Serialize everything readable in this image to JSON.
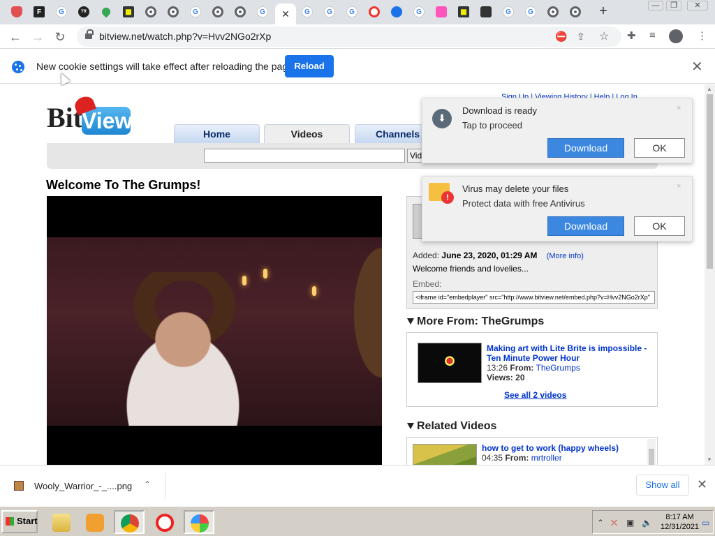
{
  "browser": {
    "url": "bitview.net/watch.php?v=Hvv2NGo2rXp",
    "tabs": [
      {
        "icon": "shield-icon"
      },
      {
        "icon": "f-square-icon",
        "glyph": "F"
      },
      {
        "icon": "google-g-icon",
        "glyph": "G"
      },
      {
        "icon": "tr-icon",
        "glyph": "TR"
      },
      {
        "icon": "maps-pin-icon"
      },
      {
        "icon": "film-icon",
        "glyph": "▦"
      },
      {
        "icon": "chrome-icon"
      },
      {
        "icon": "chrome-icon"
      },
      {
        "icon": "google-g-icon",
        "glyph": "G"
      },
      {
        "icon": "chrome-icon"
      },
      {
        "icon": "chrome-icon"
      },
      {
        "icon": "google-g-icon",
        "glyph": "G"
      },
      {
        "icon": "close-icon",
        "active": true
      },
      {
        "icon": "google-g-icon",
        "glyph": "G"
      },
      {
        "icon": "google-g-icon",
        "glyph": "G"
      },
      {
        "icon": "google-g-icon",
        "glyph": "G"
      },
      {
        "icon": "opera-icon"
      },
      {
        "icon": "history-icon"
      },
      {
        "icon": "google-g-icon",
        "glyph": "G"
      },
      {
        "icon": "art-icon"
      },
      {
        "icon": "film-icon",
        "glyph": "▦"
      },
      {
        "icon": "spy-hat-icon"
      },
      {
        "icon": "google-g-icon",
        "glyph": "G"
      },
      {
        "icon": "google-g-icon",
        "glyph": "G"
      },
      {
        "icon": "chrome-icon"
      },
      {
        "icon": "chrome-icon"
      }
    ],
    "new_tab": "+",
    "window_controls": [
      "—",
      "❐",
      "✕"
    ]
  },
  "infobar": {
    "message": "New cookie settings will take effect after reloading the page",
    "reload_label": "Reload",
    "close": "✕"
  },
  "site": {
    "logo_bit": "Bit",
    "logo_view": "View",
    "toplinks": "Sign Up | Viewing History | Help | Log In",
    "nav_tabs": [
      "Home",
      "Videos",
      "Channels"
    ],
    "search_value": "",
    "search_button": "Videos"
  },
  "video": {
    "title": "Welcome To The Grumps!",
    "added_label": "Added:",
    "added_value": "June 23, 2020, 01:29 AM",
    "more_info": "(More info)",
    "description": "Welcome friends and lovelies...",
    "embed_label": "Embed:",
    "embed_code": "<iframe id=\"embedplayer\" src=\"http://www.bitview.net/embed.php?v=Hvv2NGo2rXp\""
  },
  "more_from": {
    "heading": "More From: TheGrumps",
    "item": {
      "title": "Making art with Lite Brite is impossible - Ten Minute Power Hour",
      "duration": "13:26",
      "from_label": "From:",
      "channel": "TheGrumps",
      "views_label": "Views:",
      "views": "20"
    },
    "see_all": "See all 2 videos"
  },
  "related": {
    "heading": "Related Videos",
    "item": {
      "title": "how to get to work (happy wheels)",
      "duration": "04:35",
      "from_label": "From:",
      "channel": "mrtroller"
    }
  },
  "notifications": [
    {
      "title": "Download is ready",
      "subtitle": "Tap to proceed",
      "download": "Download",
      "ok": "OK",
      "close": "×"
    },
    {
      "title": "Virus may delete your files",
      "subtitle": "Protect data with free Antivirus",
      "download": "Download",
      "ok": "OK",
      "close": "×"
    }
  ],
  "download_bar": {
    "filename": "Wooly_Warrior_-_....png",
    "show_all": "Show all",
    "close": "✕"
  },
  "taskbar": {
    "start": "Start",
    "time": "8:17 AM",
    "date": "12/31/2021",
    "apps": [
      "file-manager-icon",
      "media-player-icon",
      "chrome-icon",
      "opera-icon",
      "windows-icon"
    ]
  }
}
